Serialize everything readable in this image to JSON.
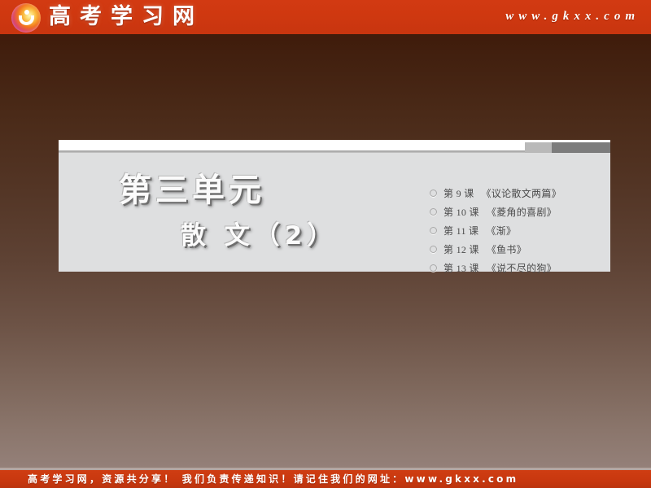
{
  "header": {
    "logo_icon": "gkxx-circle-logo-icon",
    "site_name": "高考学习网",
    "site_url": "www.gkxx.com"
  },
  "panel": {
    "unit_title": "第三单元",
    "unit_subtitle": "散 文（2）",
    "accent_bar": {
      "light_color": "#b9b9b9",
      "dark_color": "#7c7c7c"
    },
    "lessons": [
      {
        "bullet_icon": "circle-bullet-icon",
        "number": "第 9 课",
        "name": "《议论散文两篇》"
      },
      {
        "bullet_icon": "circle-bullet-icon",
        "number": "第 10 课",
        "name": "《菱角的喜剧》"
      },
      {
        "bullet_icon": "circle-bullet-icon",
        "number": "第 11 课",
        "name": "《渐》"
      },
      {
        "bullet_icon": "circle-bullet-icon",
        "number": "第 12 课",
        "name": "《鱼书》"
      },
      {
        "bullet_icon": "circle-bullet-icon",
        "number": "第 13 课",
        "name": "《说不尽的狗》"
      }
    ]
  },
  "footer": {
    "text": "高考学习网，资源共分享！ 我们负责传递知识！请记住我们的网址：www.gkxx.com"
  },
  "colors": {
    "brand_red": "#cf3810",
    "panel_gray": "#dedfe0",
    "background_top": "#3a1505",
    "background_bottom": "#998680"
  }
}
